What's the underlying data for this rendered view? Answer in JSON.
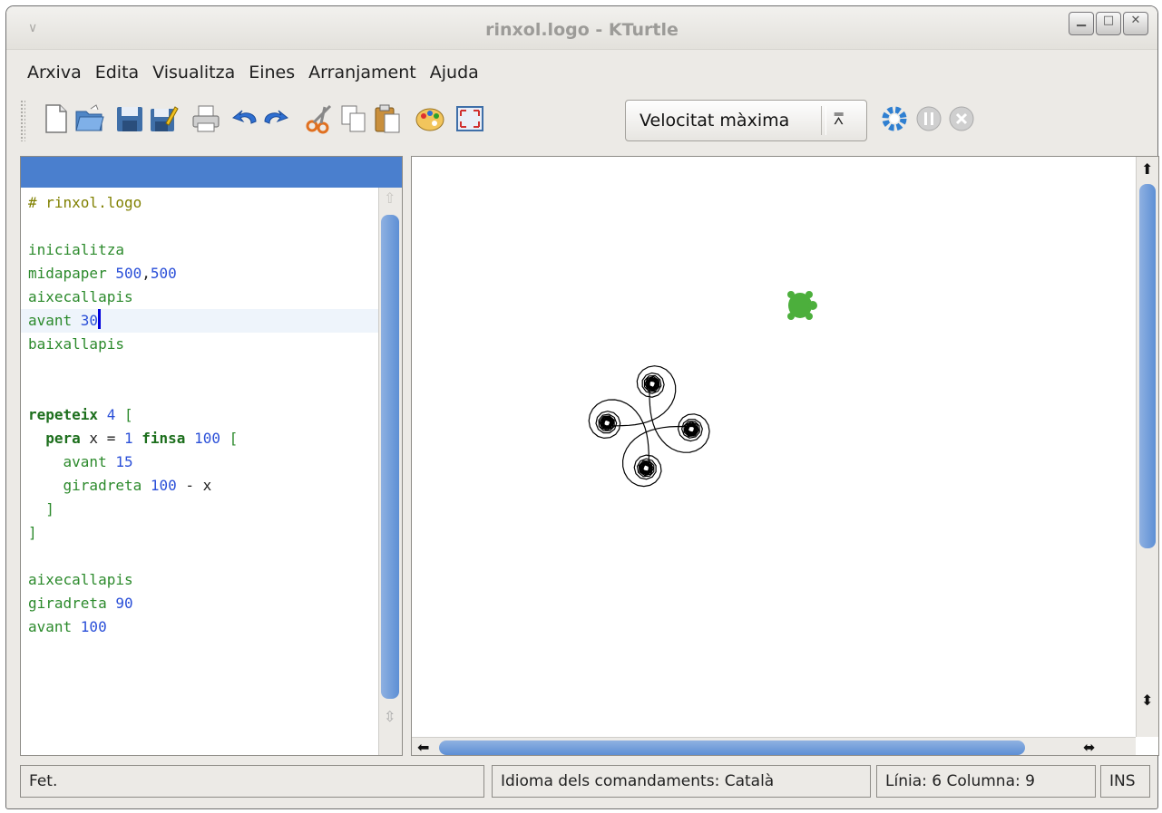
{
  "window": {
    "title": "rinxol.logo - KTurtle"
  },
  "menu": [
    "Arxiva",
    "Edita",
    "Visualitza",
    "Eines",
    "Arranjament",
    "Ajuda"
  ],
  "toolbar": {
    "icons": [
      "new-file-icon",
      "open-file-icon",
      "save-icon",
      "save-as-icon",
      "print-icon",
      "undo-icon",
      "redo-icon",
      "cut-icon",
      "copy-icon",
      "paste-icon",
      "colour-picker-icon",
      "fullscreen-icon"
    ],
    "speed": "Velocitat màxima",
    "run_icons": [
      "run-icon",
      "pause-icon",
      "stop-icon"
    ]
  },
  "editor": {
    "lines": [
      [
        {
          "t": "# rinxol.logo",
          "c": "comment"
        }
      ],
      [],
      [
        {
          "t": "inicialitza",
          "c": "cmd"
        }
      ],
      [
        {
          "t": "midapaper ",
          "c": "cmd"
        },
        {
          "t": "500",
          "c": "num"
        },
        {
          "t": ",",
          "c": "var"
        },
        {
          "t": "500",
          "c": "num"
        }
      ],
      [
        {
          "t": "aixecallapis",
          "c": "cmd"
        }
      ],
      [
        {
          "t": "avant ",
          "c": "cmd"
        },
        {
          "t": "30",
          "c": "num"
        },
        {
          "t": "",
          "c": "caret"
        }
      ],
      [
        {
          "t": "baixallapis",
          "c": "cmd"
        }
      ],
      [],
      [],
      [
        {
          "t": "repeteix",
          "c": "kw"
        },
        {
          "t": " ",
          "c": "var"
        },
        {
          "t": "4",
          "c": "num"
        },
        {
          "t": " ",
          "c": "var"
        },
        {
          "t": "[",
          "c": "cmd"
        }
      ],
      [
        {
          "t": "  ",
          "c": "var"
        },
        {
          "t": "pera",
          "c": "kw"
        },
        {
          "t": " x = ",
          "c": "var"
        },
        {
          "t": "1",
          "c": "num"
        },
        {
          "t": " ",
          "c": "var"
        },
        {
          "t": "finsa",
          "c": "kw"
        },
        {
          "t": " ",
          "c": "var"
        },
        {
          "t": "100",
          "c": "num"
        },
        {
          "t": " ",
          "c": "var"
        },
        {
          "t": "[",
          "c": "cmd"
        }
      ],
      [
        {
          "t": "    avant ",
          "c": "cmd"
        },
        {
          "t": "15",
          "c": "num"
        }
      ],
      [
        {
          "t": "    giradreta ",
          "c": "cmd"
        },
        {
          "t": "100",
          "c": "num"
        },
        {
          "t": " - x",
          "c": "var"
        }
      ],
      [
        {
          "t": "  ]",
          "c": "cmd"
        }
      ],
      [
        {
          "t": "]",
          "c": "cmd"
        }
      ],
      [],
      [
        {
          "t": "aixecallapis",
          "c": "cmd"
        }
      ],
      [
        {
          "t": "giradreta ",
          "c": "cmd"
        },
        {
          "t": "90",
          "c": "num"
        }
      ],
      [
        {
          "t": "avant ",
          "c": "cmd"
        },
        {
          "t": "100",
          "c": "num"
        }
      ]
    ],
    "current_line": 6
  },
  "status": {
    "message": "Fet.",
    "language": "Idioma dels comandaments: Català",
    "position": "Línia: 6 Columna: 9",
    "mode": "INS"
  },
  "colors": {
    "accent": "#4a7fce",
    "turtle": "#4caf3c"
  }
}
